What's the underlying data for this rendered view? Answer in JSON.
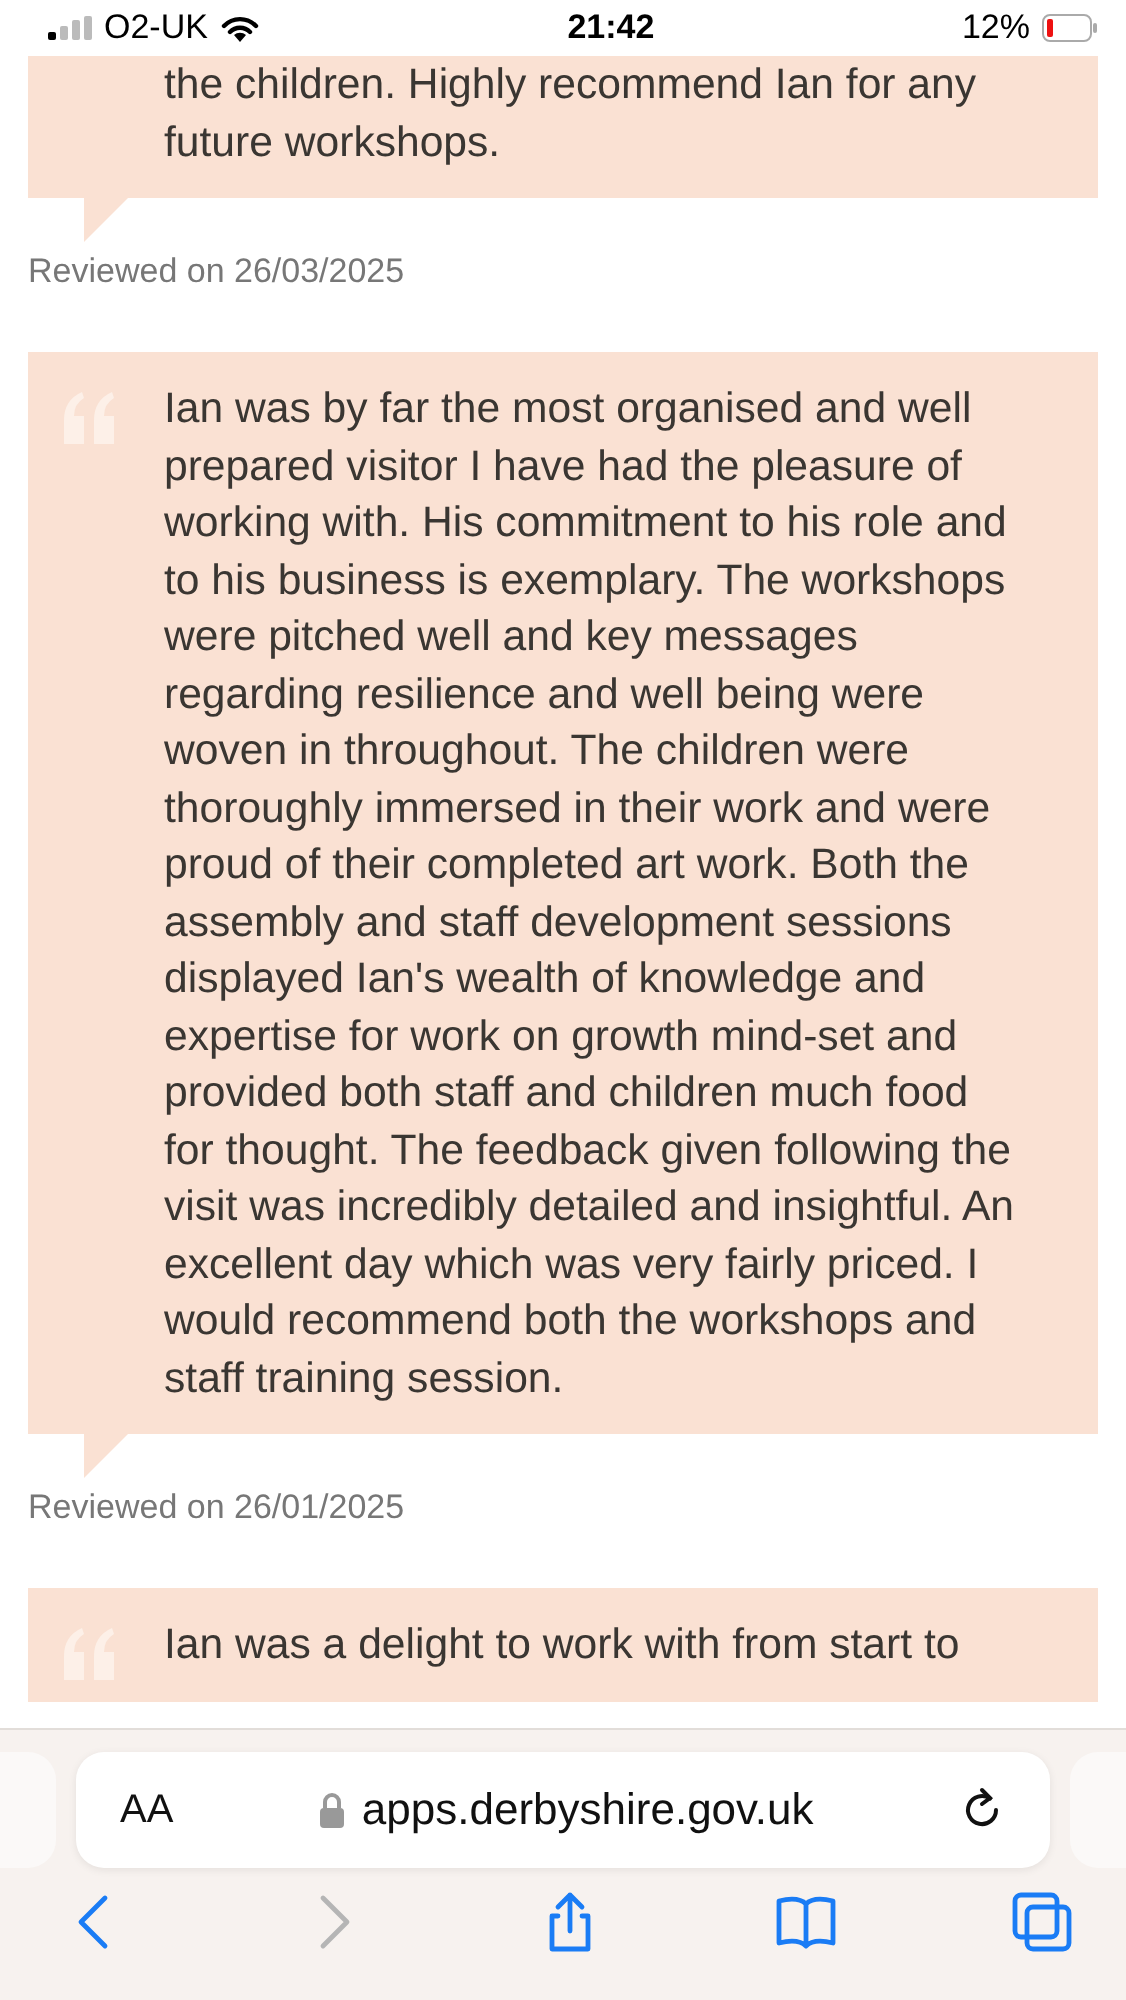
{
  "status_bar": {
    "carrier": "O2-UK",
    "time": "21:42",
    "battery": "12%"
  },
  "reviews": [
    {
      "text": "the children. Highly recommend Ian for any future workshops.",
      "date": "Reviewed on 26/03/2025",
      "quote_mark": false
    },
    {
      "text": "Ian was by far the most organised and well prepared visitor I have had the pleasure of working with. His commitment to his role and to his business is exemplary. The workshops were pitched well and key messages regarding resilience and well being were woven in throughout. The children were thoroughly immersed in their work and were proud of their completed art work. Both the assembly and staff development sessions displayed Ian's wealth of knowledge and expertise for work on growth mind-set and provided both staff and children much food for thought. The feedback given following the visit was incredibly detailed and insightful. An excellent day which was very fairly priced. I would recommend both the workshops and staff training session.",
      "date": "Reviewed on 26/01/2025",
      "quote_mark": true
    },
    {
      "text": "Ian was a delight to work with from start to",
      "quote_mark": true
    }
  ],
  "browser": {
    "text_size": "AA",
    "url": "apps.derbyshire.gov.uk",
    "nav": [
      {
        "kind": "back",
        "disabled": false
      },
      {
        "kind": "forward",
        "disabled": true
      },
      {
        "kind": "share",
        "disabled": false
      },
      {
        "kind": "bookmarks",
        "disabled": false
      },
      {
        "kind": "tabs",
        "disabled": false
      }
    ]
  }
}
